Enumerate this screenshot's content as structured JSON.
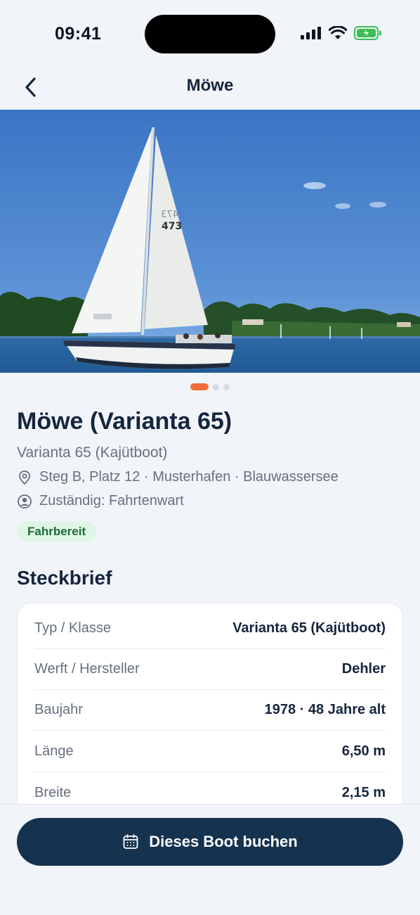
{
  "status_bar": {
    "time": "09:41"
  },
  "nav": {
    "title": "Möwe"
  },
  "hero": {
    "sail_number": "473",
    "sail_number_mirrored": "473",
    "carousel": {
      "count": 3,
      "active_index": 0
    }
  },
  "boat": {
    "title": "Möwe (Varianta 65)",
    "subtitle": "Varianta 65 (Kajütboot)",
    "location": "Steg B, Platz 12 · Musterhafen · Blauwassersee",
    "responsible": "Zuständig: Fahrtenwart",
    "status": "Fahrbereit"
  },
  "steckbrief": {
    "title": "Steckbrief",
    "rows": [
      {
        "label": "Typ / Klasse",
        "value": "Varianta 65 (Kajütboot)"
      },
      {
        "label": "Werft / Hersteller",
        "value": "Dehler"
      },
      {
        "label": "Baujahr",
        "value": "1978 · 48 Jahre alt"
      },
      {
        "label": "Länge",
        "value": "6,50 m"
      },
      {
        "label": "Breite",
        "value": "2,15 m"
      }
    ]
  },
  "cta": {
    "label": "Dieses Boot buchen"
  },
  "colors": {
    "accent": "#f26b3a",
    "primary": "#15324f",
    "status_green": "#1f6b36"
  },
  "icons": [
    "chevron-left-icon",
    "signal-icon",
    "wifi-icon",
    "battery-charging-icon",
    "location-pin-icon",
    "user-circle-icon",
    "calendar-icon"
  ]
}
